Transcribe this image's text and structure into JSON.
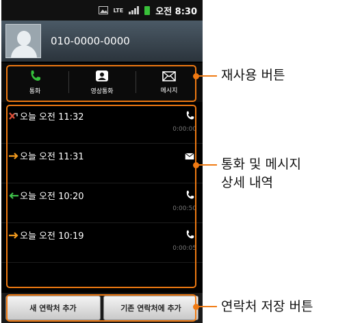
{
  "status_bar": {
    "network": "LTE",
    "time": "오전 8:30"
  },
  "contact": {
    "number": "010-0000-0000"
  },
  "reuse_buttons": [
    {
      "label": "통화",
      "icon": "phone-icon",
      "color": "#35c13b"
    },
    {
      "label": "영상통화",
      "icon": "video-call-icon",
      "color": "#ffffff"
    },
    {
      "label": "메시지",
      "icon": "envelope-icon",
      "color": "#ffffff"
    }
  ],
  "history": [
    {
      "direction": "missed",
      "time": "오늘 오전 11:32",
      "type": "call",
      "duration": "0:00:00"
    },
    {
      "direction": "outgoing",
      "time": "오늘 오전 11:31",
      "type": "message",
      "duration": ""
    },
    {
      "direction": "incoming",
      "time": "오늘 오전 10:20",
      "type": "call",
      "duration": "0:00:50"
    },
    {
      "direction": "outgoing",
      "time": "오늘 오전 10:19",
      "type": "call",
      "duration": "0:00:05"
    }
  ],
  "save_buttons": {
    "new_contact": "새 연락처 추가",
    "existing_contact": "기존 연락처에 추가"
  },
  "callouts": {
    "reuse": "재사용 버튼",
    "history_line1": "통화 및 메시지",
    "history_line2": "상세 내역",
    "save": "연락처 저장 버튼"
  },
  "colors": {
    "callout": "#f07a12",
    "missed": "#e0503a",
    "outgoing": "#f39a1e",
    "incoming": "#3fc24a"
  }
}
